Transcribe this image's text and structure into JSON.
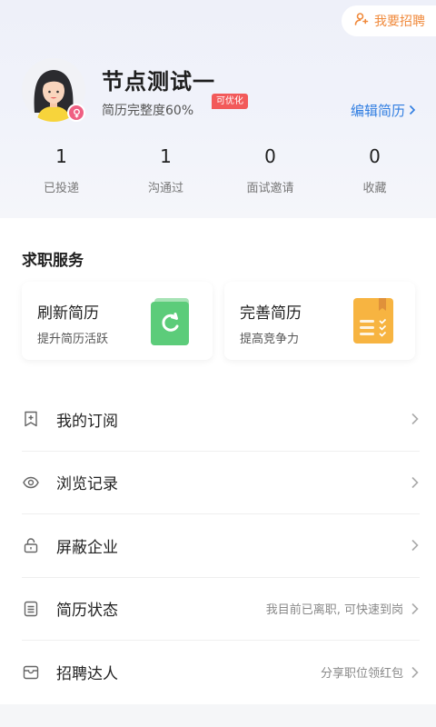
{
  "header": {
    "recruit_label": "我要招聘",
    "name": "节点测试一",
    "completion": "简历完整度60%",
    "optimize_tag": "可优化",
    "edit_resume": "编辑简历"
  },
  "stats": [
    {
      "value": "1",
      "label": "已投递"
    },
    {
      "value": "1",
      "label": "沟通过"
    },
    {
      "value": "0",
      "label": "面试邀请"
    },
    {
      "value": "0",
      "label": "收藏"
    }
  ],
  "services": {
    "title": "求职服务",
    "cards": [
      {
        "title": "刷新简历",
        "subtitle": "提升简历活跃",
        "icon": "refresh-icon"
      },
      {
        "title": "完善简历",
        "subtitle": "提高竞争力",
        "icon": "resume-book-icon"
      }
    ]
  },
  "menu": [
    {
      "label": "我的订阅",
      "value": "",
      "icon": "bookmark-icon"
    },
    {
      "label": "浏览记录",
      "value": "",
      "icon": "eye-icon"
    },
    {
      "label": "屏蔽企业",
      "value": "",
      "icon": "lock-icon"
    },
    {
      "label": "简历状态",
      "value": "我目前已离职, 可快速到岗",
      "icon": "document-icon"
    },
    {
      "label": "招聘达人",
      "value": "分享职位领红包",
      "icon": "wallet-icon"
    }
  ],
  "colors": {
    "accent_blue": "#2f7de1",
    "recruit_orange": "#f08a3c",
    "tag_red": "#f25a5a",
    "refresh_green": "#5ccc7a",
    "resume_orange": "#f7b441"
  }
}
